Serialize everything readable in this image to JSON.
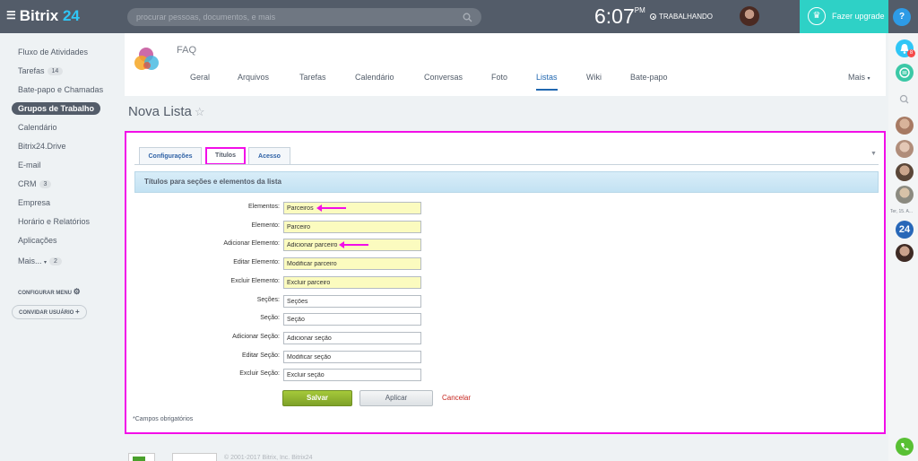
{
  "header": {
    "logo_name": "Bitrix",
    "logo_num": "24",
    "search_placeholder": "procurar pessoas, documentos, e mais",
    "clock": "6:07",
    "clock_suffix": "PM",
    "status": "TRABALHANDO",
    "upgrade_label": "Fazer upgrade",
    "help_label": "?"
  },
  "sidebar": {
    "items": [
      {
        "label": "Fluxo de Atividades"
      },
      {
        "label": "Tarefas",
        "count": "14"
      },
      {
        "label": "Bate-papo e Chamadas"
      },
      {
        "label": "Grupos de Trabalho",
        "active": true
      },
      {
        "label": "Calendário"
      },
      {
        "label": "Bitrix24.Drive"
      },
      {
        "label": "E-mail"
      },
      {
        "label": "CRM",
        "count": "3"
      },
      {
        "label": "Empresa"
      },
      {
        "label": "Horário e Relatórios"
      },
      {
        "label": "Aplicações"
      },
      {
        "label": "Mais...",
        "count": "2"
      }
    ],
    "configure_menu": "CONFIGURAR MENU",
    "invite_user": "CONVIDAR USUÁRIO"
  },
  "group": {
    "name": "FAQ",
    "tabs": [
      "Geral",
      "Arquivos",
      "Tarefas",
      "Calendário",
      "Conversas",
      "Foto",
      "Listas",
      "Wiki",
      "Bate-papo"
    ],
    "active_tab": "Listas",
    "more": "Mais"
  },
  "page": {
    "title": "Nova Lista"
  },
  "form": {
    "tabs": [
      "Configurações",
      "Títulos",
      "Acesso"
    ],
    "active_tab": "Títulos",
    "section_title": "Títulos para seções e elementos da lista",
    "fields": [
      {
        "label": "Elementos:",
        "value": "Parceiros",
        "required": true
      },
      {
        "label": "Elemento:",
        "value": "Parceiro",
        "required": true
      },
      {
        "label": "Adicionar Elemento:",
        "value": "Adicionar parceiro",
        "required": true
      },
      {
        "label": "Editar Elemento:",
        "value": "Modificar parceiro",
        "required": true
      },
      {
        "label": "Excluir Elemento:",
        "value": "Excluir parceiro",
        "required": true
      },
      {
        "label": "Seções:",
        "value": "Seções",
        "required": false
      },
      {
        "label": "Seção:",
        "value": "Seção",
        "required": false
      },
      {
        "label": "Adicionar Seção:",
        "value": "Adicionar seção",
        "required": false
      },
      {
        "label": "Editar Seção:",
        "value": "Modificar seção",
        "required": false
      },
      {
        "label": "Excluir Seção:",
        "value": "Excluir seção",
        "required": false
      }
    ],
    "save": "Salvar",
    "apply": "Aplicar",
    "cancel": "Cancelar",
    "required_note": "*Campos obrigatórios"
  },
  "footer": {
    "text": "© 2001-2017 Bitrix, Inc.   Bitrix24"
  },
  "rightbar": {
    "date": "Ter, 15. A...",
    "badge": "8",
    "b24": "24"
  },
  "colors": {
    "topbar": "#535c69",
    "accent": "#2067b0",
    "highlight": "#f20ee8",
    "upgrade": "#2ed1c6",
    "required_bg": "#fbfbbf"
  }
}
